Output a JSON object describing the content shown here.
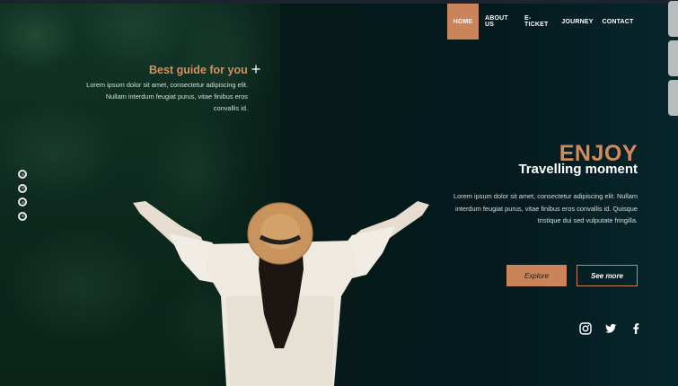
{
  "nav": {
    "items": [
      {
        "label": "HOME",
        "active": true
      },
      {
        "label": "ABOUT US",
        "active": false
      },
      {
        "label": "E-TICKET",
        "active": false
      },
      {
        "label": "JOURNEY",
        "active": false
      },
      {
        "label": "CONTACT",
        "active": false
      }
    ]
  },
  "guide": {
    "title": "Best guide for you",
    "text": "Lorem ipsum dolor sit amet, consectetur adipiscing elit. Nullam interdum feugiat purus, vitae finibus eros convallis id."
  },
  "slider": {
    "dot_count": 4
  },
  "hero": {
    "headline": "ENJOY",
    "tagline": "Travelling moment",
    "text": "Lorem ipsum dolor sit amet, consectetur adipiscing elit. Nullam interdum feugiat purus, vitae finibus eros convallis id. Quisque tristique dui sed vulputate fringilla.",
    "explore_label": "Explore",
    "see_more_label": "See more"
  },
  "social": [
    "instagram-icon",
    "twitter-icon",
    "facebook-icon"
  ],
  "colors": {
    "accent": "#c9845a",
    "headline": "#d08a5c",
    "background": "#051a18",
    "text": "#ffffff"
  }
}
